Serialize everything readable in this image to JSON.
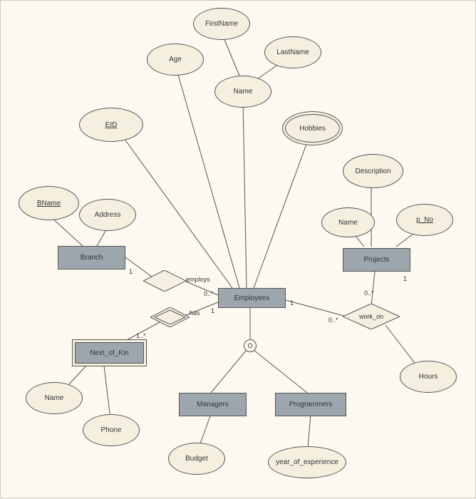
{
  "entities": {
    "branch": "Branch",
    "employees": "Employees",
    "projects": "Projects",
    "next_of_kin": "Next_of_Kin",
    "managers": "Managers",
    "programmers": "Programmers"
  },
  "attributes": {
    "bname": "BName",
    "address": "Address",
    "eid": "EID",
    "age": "Age",
    "firstname": "FirstName",
    "lastname": "LastName",
    "emp_name": "Name",
    "hobbies": "Hobbies",
    "description": "Description",
    "proj_name": "Name",
    "p_no": "p_No",
    "nok_name": "Name",
    "phone": "Phone",
    "budget": "Budget",
    "year_exp": "year_of_experience",
    "hours": "Hours"
  },
  "relationships": {
    "employs": "employs",
    "has": "has",
    "work_on": "work_on"
  },
  "inheritance": {
    "symbol": "O"
  },
  "cardinalities": {
    "branch_employs": "1",
    "employs_emp": "0..*",
    "emp_has": "1",
    "has_nok": "1..*",
    "emp_workon": "1",
    "workon_emp": "0..*",
    "workon_proj": "0..*",
    "proj_workon": "1"
  }
}
